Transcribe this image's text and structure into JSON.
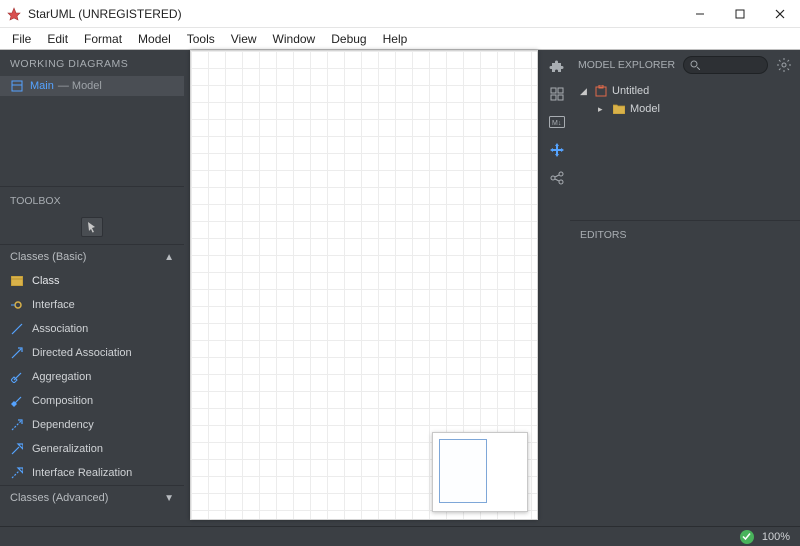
{
  "window": {
    "title": "StarUML (UNREGISTERED)"
  },
  "menubar": [
    "File",
    "Edit",
    "Format",
    "Model",
    "Tools",
    "View",
    "Window",
    "Debug",
    "Help"
  ],
  "left": {
    "working_diagrams_header": "WORKING DIAGRAMS",
    "working_diagrams": [
      {
        "name": "Main",
        "type": "— Model"
      }
    ],
    "toolbox_header": "TOOLBOX",
    "sections": [
      {
        "label": "Classes (Basic)",
        "expanded": true
      },
      {
        "label": "Classes (Advanced)",
        "expanded": false
      }
    ],
    "tools": [
      {
        "name": "Class",
        "icon": "class-icon"
      },
      {
        "name": "Interface",
        "icon": "interface-icon"
      },
      {
        "name": "Association",
        "icon": "association-icon"
      },
      {
        "name": "Directed Association",
        "icon": "directed-association-icon"
      },
      {
        "name": "Aggregation",
        "icon": "aggregation-icon"
      },
      {
        "name": "Composition",
        "icon": "composition-icon"
      },
      {
        "name": "Dependency",
        "icon": "dependency-icon"
      },
      {
        "name": "Generalization",
        "icon": "generalization-icon"
      },
      {
        "name": "Interface Realization",
        "icon": "interface-realization-icon"
      }
    ]
  },
  "right": {
    "model_explorer_header": "MODEL EXPLORER",
    "search_placeholder": "",
    "tree": {
      "root": {
        "label": "Untitled"
      },
      "child": {
        "label": "Model"
      }
    },
    "editors_header": "EDITORS"
  },
  "status": {
    "zoom": "100%"
  }
}
